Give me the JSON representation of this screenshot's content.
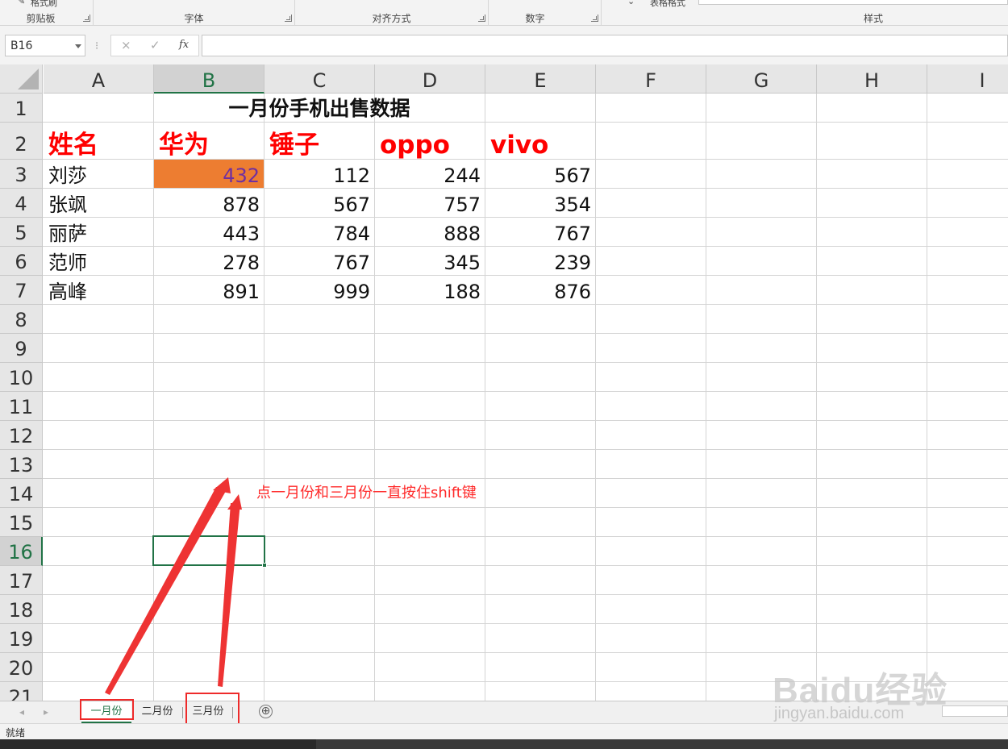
{
  "ribbon": {
    "groups": [
      "剪贴板",
      "字体",
      "对齐方式",
      "数字",
      "样式"
    ],
    "format_painter_fragment": "格式刷",
    "table_format_fragment": "表格格式"
  },
  "formula_bar": {
    "name_box": "B16",
    "cancel_icon": "×",
    "enter_icon": "✓",
    "fx_label": "fx",
    "formula": ""
  },
  "columns": [
    "A",
    "B",
    "C",
    "D",
    "E",
    "F",
    "G",
    "H",
    "I"
  ],
  "selected_column": "B",
  "rows": [
    "1",
    "2",
    "3",
    "4",
    "5",
    "6",
    "7",
    "8",
    "9",
    "10",
    "11",
    "12",
    "13",
    "14",
    "15",
    "16",
    "17",
    "18",
    "19",
    "20",
    "21"
  ],
  "selected_row": "16",
  "sheet": {
    "title": "一月份手机出售数据",
    "headers": [
      "姓名",
      "华为",
      "锤子",
      "oppo",
      "vivo"
    ],
    "data": [
      [
        "刘莎",
        "432",
        "112",
        "244",
        "567"
      ],
      [
        "张飒",
        "878",
        "567",
        "757",
        "354"
      ],
      [
        "丽萨",
        "443",
        "784",
        "888",
        "767"
      ],
      [
        "范师",
        "278",
        "767",
        "345",
        "239"
      ],
      [
        "高峰",
        "891",
        "999",
        "188",
        "876"
      ]
    ],
    "highlight_fill": "#ed7d31",
    "highlight_text_color": "#7030a0",
    "header_color": "#ff0000"
  },
  "annotation": "点一月份和三月份一直按住shift键",
  "sheet_tabs": [
    "一月份",
    "二月份",
    "三月份"
  ],
  "active_tab": "一月份",
  "add_sheet_icon": "⊕",
  "status": "就绪",
  "watermark": {
    "line1": "Baidu经验",
    "line2": "jingyan.baidu.com"
  }
}
